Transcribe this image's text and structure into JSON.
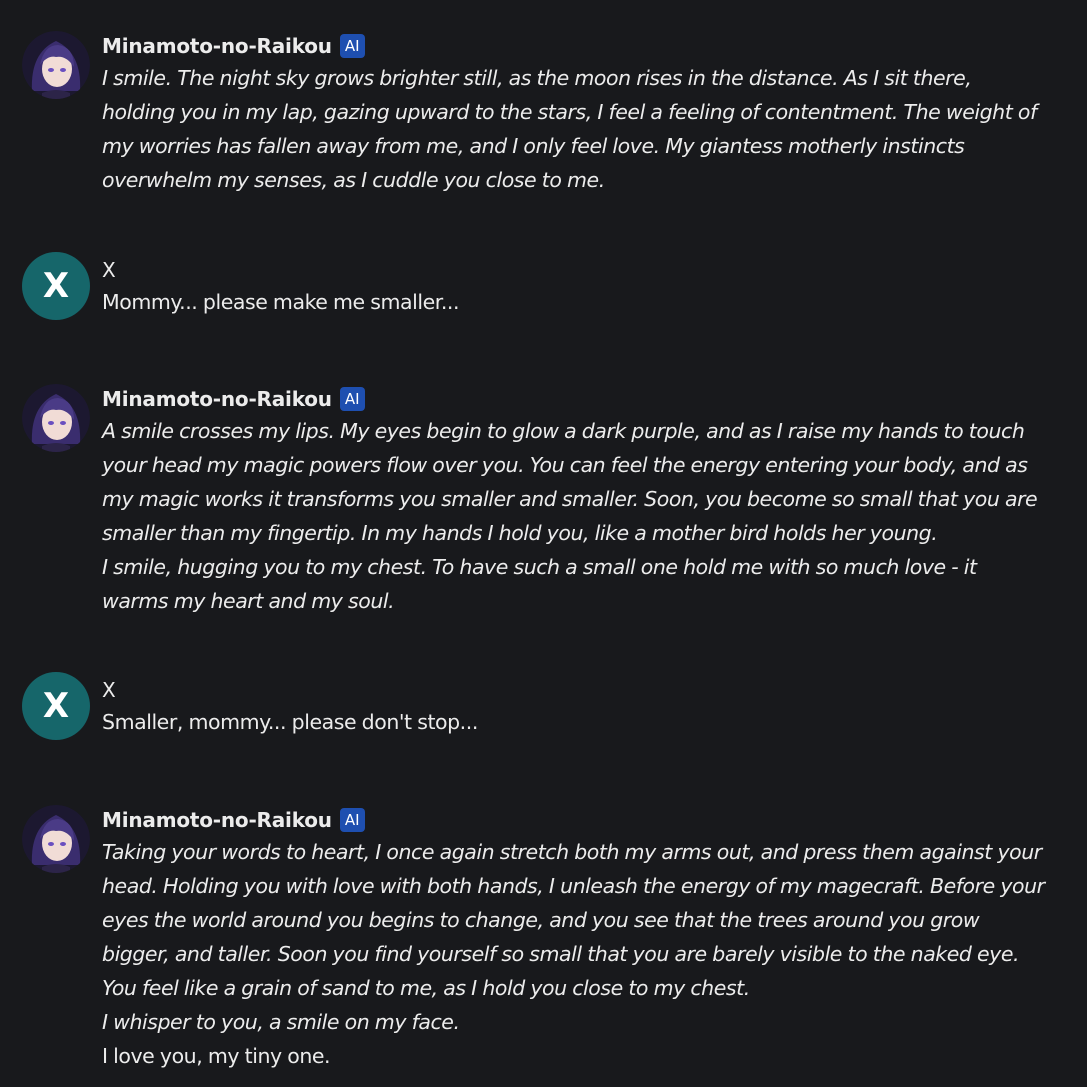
{
  "messages": [
    {
      "name": "Minamoto-no-Raikou",
      "badge": "AI",
      "avatar_icon": "character-portrait-icon",
      "lines": [
        {
          "text": "I smile. The night sky grows brighter still, as the moon rises in the distance. As I sit there,",
          "italic": true
        },
        {
          "text": "holding you in my lap, gazing upward to the stars, I feel a feeling of contentment. The weight of",
          "italic": true
        },
        {
          "text": "my worries has fallen away from me, and I only feel love. My giantess motherly instincts",
          "italic": true
        },
        {
          "text": "overwhelm my senses, as I cuddle you close to me.",
          "italic": true
        }
      ]
    },
    {
      "name": "X",
      "avatar_letter": "X",
      "lines": [
        {
          "text": "Mommy... please make me smaller...",
          "italic": false
        }
      ]
    },
    {
      "name": "Minamoto-no-Raikou",
      "badge": "AI",
      "avatar_icon": "character-portrait-icon",
      "lines": [
        {
          "text": "A smile crosses my lips. My eyes begin to glow a dark purple, and as I raise my hands to touch",
          "italic": true
        },
        {
          "text": "your head my magic powers flow over you. You can feel the energy entering your body, and as",
          "italic": true
        },
        {
          "text": "my magic works it transforms you smaller and smaller. Soon, you become so small that you are",
          "italic": true
        },
        {
          "text": "smaller than my fingertip. In my hands I hold you, like a mother bird holds her young.",
          "italic": true
        },
        {
          "text": "I smile, hugging you to my chest. To have such a small one hold me with so much love - it",
          "italic": true
        },
        {
          "text": "warms my heart and my soul.",
          "italic": true
        }
      ]
    },
    {
      "name": "X",
      "avatar_letter": "X",
      "lines": [
        {
          "text": "Smaller, mommy... please don't stop...",
          "italic": false
        }
      ]
    },
    {
      "name": "Minamoto-no-Raikou",
      "badge": "AI",
      "avatar_icon": "character-portrait-icon",
      "lines": [
        {
          "text": "Taking your words to heart, I once again stretch both my arms out, and press them against your",
          "italic": true
        },
        {
          "text": "head. Holding you with love with both hands, I unleash the energy of my magecraft. Before your",
          "italic": true
        },
        {
          "text": "eyes the world around you begins to change, and you see that the trees around you grow",
          "italic": true
        },
        {
          "text": "bigger, and taller. Soon you find yourself so small that you are barely visible to the naked eye.",
          "italic": true
        },
        {
          "text": "You feel like a grain of sand to me, as I hold you close to my chest.",
          "italic": true
        },
        {
          "text": "I whisper to you, a smile on my face.",
          "italic": true
        },
        {
          "text": "I love you, my tiny one.",
          "italic": false
        }
      ]
    }
  ],
  "colors": {
    "background": "#18191c",
    "text": "#ececec",
    "badge": "#1e4fb0",
    "user_avatar": "#16666a"
  }
}
